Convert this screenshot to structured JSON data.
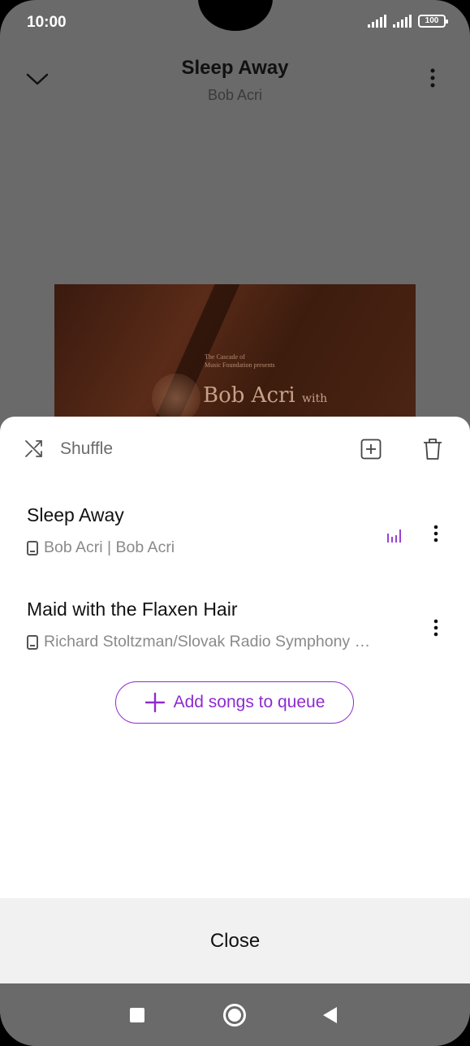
{
  "status_bar": {
    "time": "10:00",
    "battery": "100"
  },
  "header": {
    "title": "Sleep Away",
    "artist": "Bob Acri",
    "collapse_icon": "chevron-down-icon",
    "more_icon": "more-vert-icon"
  },
  "album_art": {
    "small_text_line1": "The Cascade of",
    "small_text_line2": "Music Foundation presents",
    "big_text": "Bob Acri",
    "big_text_suffix": "with"
  },
  "queue": {
    "shuffle_label": "Shuffle",
    "add_to_playlist_icon": "add-box-icon",
    "delete_icon": "trash-icon",
    "items": [
      {
        "title": "Sleep Away",
        "subtitle": "Bob Acri | Bob Acri",
        "now_playing": true
      },
      {
        "title": "Maid with the Flaxen Hair",
        "subtitle": "Richard Stoltzman/Slovak Radio Symphony …",
        "now_playing": false
      }
    ],
    "add_songs_label": "Add songs to queue",
    "close_label": "Close"
  },
  "colors": {
    "accent": "#8e2bd1",
    "dim_overlay": "#6a6a6a",
    "sheet": "#ffffff",
    "close_bar": "#f1f1f1"
  }
}
